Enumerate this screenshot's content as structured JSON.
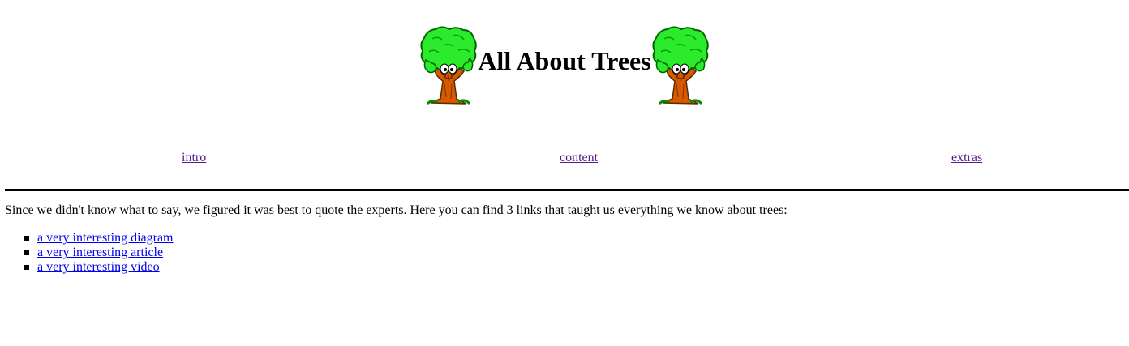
{
  "header": {
    "title": "All About Trees",
    "logo_icon": "cartoon-tree-icon"
  },
  "nav": {
    "items": [
      {
        "label": "intro"
      },
      {
        "label": "content"
      },
      {
        "label": "extras"
      }
    ]
  },
  "main": {
    "intro_text": "Since we didn't know what to say, we figured it was best to quote the experts. Here you can find 3 links that taught us everything we know about trees:",
    "links": [
      {
        "label": "a very interesting diagram"
      },
      {
        "label": "a very interesting article"
      },
      {
        "label": "a very interesting video"
      }
    ]
  },
  "colors": {
    "visited_link": "#551a8b",
    "unvisited_link": "#0000ee",
    "text": "#000000",
    "background": "#ffffff"
  }
}
